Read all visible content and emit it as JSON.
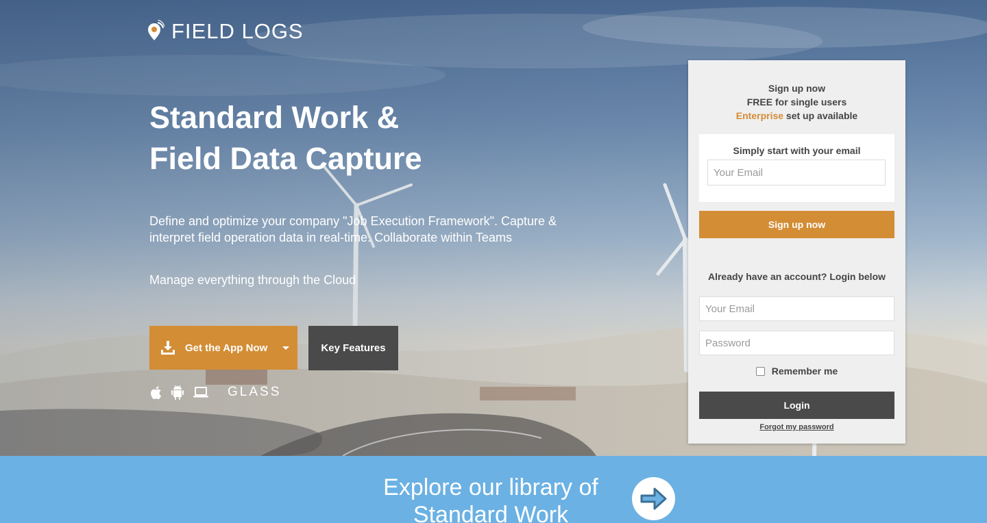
{
  "brand": {
    "name": "FIELD LOGS"
  },
  "hero": {
    "headline_line1": "Standard Work &",
    "headline_line2": "Field Data Capture",
    "lead": "Define and optimize your company \"Job Execution Framework\". Capture & interpret field operation data in real-time. Collaborate within Teams",
    "sub": "Manage everything through the Cloud",
    "app_button": "Get the App Now",
    "features_button": "Key Features",
    "platforms": {
      "icons": [
        "apple-icon",
        "android-icon",
        "laptop-icon"
      ],
      "glass": "GLASS"
    }
  },
  "signup": {
    "line1": "Sign up now",
    "line2": "FREE for single users",
    "enterprise": "Enterprise",
    "line3_rest": " set up available",
    "email_title": "Simply start with your email",
    "email_placeholder": "Your Email",
    "button": "Sign up now"
  },
  "login": {
    "title": "Already have an account? Login below",
    "email_placeholder": "Your Email",
    "password_placeholder": "Password",
    "remember": "Remember me",
    "button": "Login",
    "forgot": "Forgot my password"
  },
  "explore": {
    "text": "Explore our library of Standard Work"
  },
  "colors": {
    "accent": "#d38d35",
    "dark_button": "#4a4a4a",
    "band": "#6bb1e3",
    "panel": "#efefef"
  }
}
